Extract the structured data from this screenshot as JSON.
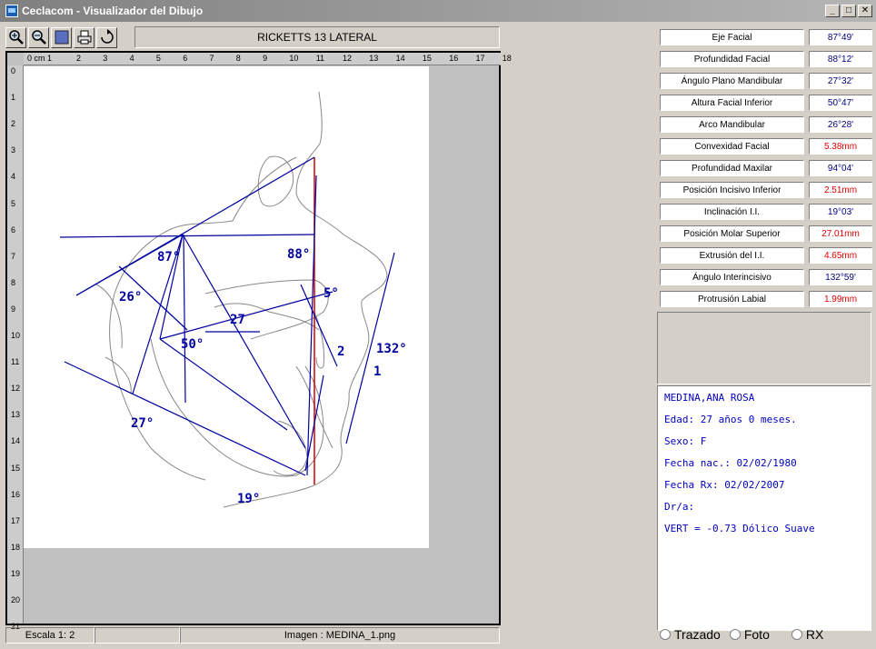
{
  "window": {
    "title": "Ceclacom - Visualizador del Dibujo"
  },
  "toolbar": {
    "analysis_title": "RICKETTS 13 LATERAL",
    "tools": [
      "zoom-in-icon",
      "zoom-out-icon",
      "fit-view-icon",
      "print-icon",
      "rotate-icon"
    ]
  },
  "ruler": {
    "unit_label": "0 cm 1",
    "top_ticks": [
      "2",
      "3",
      "4",
      "5",
      "6",
      "7",
      "8",
      "9",
      "10",
      "11",
      "12",
      "13",
      "14",
      "15",
      "16",
      "17",
      "18"
    ],
    "left_ticks": [
      "0",
      "1",
      "2",
      "3",
      "4",
      "5",
      "6",
      "7",
      "8",
      "9",
      "10",
      "11",
      "12",
      "13",
      "14",
      "15",
      "16",
      "17",
      "18",
      "19",
      "20",
      "21"
    ]
  },
  "drawing": {
    "angle_labels": [
      "87°",
      "88°",
      "26°",
      "5°",
      "27",
      "50°",
      "2",
      "132°",
      "1",
      "27°",
      "19°"
    ]
  },
  "statusbar": {
    "scale": "Escala  1: 2",
    "middle": "",
    "image": "Imagen : MEDINA_1.png"
  },
  "measurements": [
    {
      "label": "Eje Facial",
      "value": "87°49'",
      "color": "#000080"
    },
    {
      "label": "Profundidad Facial",
      "value": "88°12'",
      "color": "#000080"
    },
    {
      "label": "Ángulo Plano Mandibular",
      "value": "27°32'",
      "color": "#000080"
    },
    {
      "label": "Altura Facial Inferior",
      "value": "50°47'",
      "color": "#000080"
    },
    {
      "label": "Arco Mandibular",
      "value": "26°28'",
      "color": "#000080"
    },
    {
      "label": "Convexidad Facial",
      "value": "5.38mm",
      "color": "#e00000"
    },
    {
      "label": "Profundidad Maxilar",
      "value": "94°04'",
      "color": "#000080"
    },
    {
      "label": "Posición Incisivo Inferior",
      "value": "2.51mm",
      "color": "#e00000"
    },
    {
      "label": "Inclinación I.I.",
      "value": "19°03'",
      "color": "#000080"
    },
    {
      "label": "Posición Molar Superior",
      "value": "27.01mm",
      "color": "#e00000"
    },
    {
      "label": "Extrusión del I.I.",
      "value": "4.65mm",
      "color": "#e00000"
    },
    {
      "label": "Ángulo Interincisivo",
      "value": "132°59'",
      "color": "#000080"
    },
    {
      "label": "Protrusión Labial",
      "value": "1.99mm",
      "color": "#e00000"
    }
  ],
  "patient": {
    "name": "MEDINA,ANA ROSA",
    "age": "Edad: 27 años 0 meses.",
    "sex": "Sexo: F",
    "birth": "Fecha nac.: 02/02/1980",
    "xray": "Fecha Rx: 02/02/2007",
    "doctor": "Dr/a:",
    "vert": "VERT = -0.73 Dólico Suave"
  },
  "view_options": [
    "Trazado",
    "Foto",
    "RX"
  ]
}
